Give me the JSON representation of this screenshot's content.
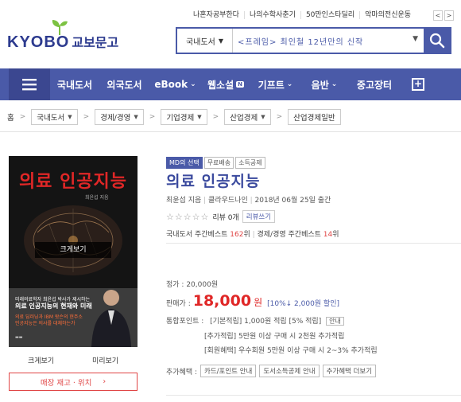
{
  "top_links": [
    "나혼자공부한다",
    "나의수학사춘기",
    "50만인스타딜리",
    "악마의전신운동"
  ],
  "logo": {
    "en": "KYOBO",
    "ko": "교보문고"
  },
  "search": {
    "category": "국내도서",
    "placeholder": "<프레임> 최인철 12년만의 신작"
  },
  "nav": {
    "items": [
      {
        "label": "국내도서",
        "chevron": false,
        "badge": ""
      },
      {
        "label": "외국도서",
        "chevron": false,
        "badge": ""
      },
      {
        "label": "eBook",
        "chevron": true,
        "badge": ""
      },
      {
        "label": "웹소설",
        "chevron": false,
        "badge": "N"
      },
      {
        "label": "기프트",
        "chevron": true,
        "badge": ""
      },
      {
        "label": "음반",
        "chevron": true,
        "badge": ""
      },
      {
        "label": "중고장터",
        "chevron": false,
        "badge": ""
      }
    ]
  },
  "breadcrumb": {
    "home": "홈",
    "levels": [
      "국내도서",
      "경제/경영",
      "기업경제",
      "산업경제"
    ],
    "current": "산업경제일반"
  },
  "cover": {
    "title": "의료 인공지능",
    "author_line": "최윤섭 지음",
    "zoom_label": "크게보기",
    "blurb1": "미래의료학자 최윤섭 박사가 제시하는",
    "blurb2": "의료 인공지능의 현재와 미래",
    "blurb3": "의료 딥러닝과 IBM 왓슨의 현주소",
    "blurb4": "인공지능은 의사를 대체하는가"
  },
  "cover_actions": {
    "zoom": "크게보기",
    "preview": "미리보기"
  },
  "stock_button": {
    "label": "매장 재고 · 위치",
    "arrow": "›"
  },
  "tags": [
    "MD의 선택",
    "무료배송",
    "소득공제"
  ],
  "book": {
    "title": "의료 인공지능",
    "author": "최윤섭 지음",
    "publisher": "클라우드나인",
    "date": "2018년 06월 25일 출간"
  },
  "rating": {
    "stars": "☆☆☆☆☆",
    "review_text": "리뷰 0개",
    "review_button": "리뷰쓰기"
  },
  "bestseller": {
    "part1_label": "국내도서 주간베스트 ",
    "part1_rank": "162",
    "part1_unit": "위",
    "part2_label": "경제/경영 주간베스트 ",
    "part2_rank": "14",
    "part2_unit": "위"
  },
  "price": {
    "list_label": "정가 : ",
    "list_value": "20,000원",
    "sale_label": "판매가 :",
    "sale_value": "18,000",
    "sale_unit": "원",
    "discount": "[10%↓ 2,000원 할인]"
  },
  "points": {
    "label": "통합포인트 :",
    "basic": "[기본적립] 1,000원 적립 [5% 적립]",
    "info_button": "안내",
    "additional": "[추가적립] 5만원 이상 구매 시 2천원 추가적립",
    "member": "[회원혜택] 우수회원 5만원 이상 구매 시 2~3% 추가적립"
  },
  "extra": {
    "label": "추가혜택 :",
    "buttons": [
      "카드/포인트 안내",
      "도서소득공제 안내",
      "추가혜택 더보기"
    ]
  },
  "colors": {
    "brand": "#4a5aa8",
    "accent": "#e02727",
    "logo_green": "#7cc242"
  }
}
